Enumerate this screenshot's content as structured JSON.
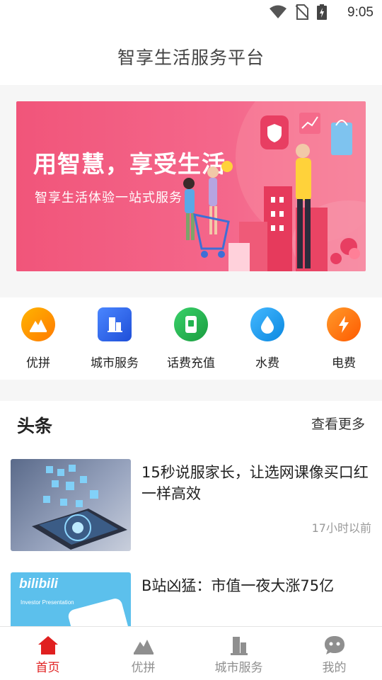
{
  "status_bar": {
    "time": "9:05"
  },
  "header": {
    "title": "智享生活服务平台"
  },
  "banner": {
    "headline": "用智慧，享受生活",
    "subline": "智享生活体验一站式服务"
  },
  "quick_menu": [
    {
      "label": "优拼",
      "icon": "mountain-icon",
      "color": "#ff8c00"
    },
    {
      "label": "城市服务",
      "icon": "city-building-icon",
      "color": "#2f66f5"
    },
    {
      "label": "话费充值",
      "icon": "phone-card-icon",
      "color": "#22b34f"
    },
    {
      "label": "水费",
      "icon": "water-drop-icon",
      "color": "#1a9cf0"
    },
    {
      "label": "电费",
      "icon": "lightning-icon",
      "color": "#ff6a00"
    }
  ],
  "news": {
    "title": "头条",
    "more_label": "查看更多",
    "items": [
      {
        "title": "15秒说服家长，让选网课像买口红一样高效",
        "time": "17小时以前"
      },
      {
        "title": "B站凶猛：市值一夜大涨75亿",
        "thumb_brand": "bilibili",
        "thumb_caption": "Investor Presentation"
      }
    ]
  },
  "tab_bar": [
    {
      "label": "首页",
      "icon": "home-icon",
      "active": true
    },
    {
      "label": "优拼",
      "icon": "mountain-icon",
      "active": false
    },
    {
      "label": "城市服务",
      "icon": "city-building-icon",
      "active": false
    },
    {
      "label": "我的",
      "icon": "chat-face-icon",
      "active": false
    }
  ],
  "colors": {
    "accent": "#e02020",
    "banner": "#f1557a",
    "inactive_tab": "#8f8f8f"
  }
}
